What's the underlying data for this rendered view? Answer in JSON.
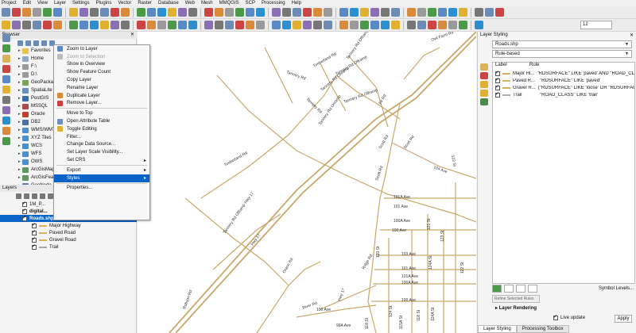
{
  "menubar": [
    "Project",
    "Edit",
    "View",
    "Layer",
    "Settings",
    "Plugins",
    "Vector",
    "Raster",
    "Database",
    "Web",
    "Mesh",
    "MMQGIS",
    "SCP",
    "Processing",
    "Help"
  ],
  "toolbar": {
    "scale_value": "12"
  },
  "browser": {
    "title": "Browser",
    "items": [
      {
        "label": "Favorites",
        "color": "#e8c24a"
      },
      {
        "label": "Home",
        "color": "#8fa9c9"
      },
      {
        "label": "F:\\",
        "color": "#9a9a9a"
      },
      {
        "label": "D:\\",
        "color": "#9a9a9a"
      },
      {
        "label": "GeoPackage",
        "color": "#7aa35b"
      },
      {
        "label": "SpatiaLite",
        "color": "#6a8fbf"
      },
      {
        "label": "PostGIS",
        "color": "#3d6ea8"
      },
      {
        "label": "MSSQL",
        "color": "#b04a4a"
      },
      {
        "label": "Oracle",
        "color": "#c04030"
      },
      {
        "label": "DB2",
        "color": "#4a6fa5"
      },
      {
        "label": "WMS/WMTS",
        "color": "#4a8fd0"
      },
      {
        "label": "XYZ Tiles",
        "color": "#4a8fd0"
      },
      {
        "label": "WCS",
        "color": "#4a8fd0"
      },
      {
        "label": "WFS",
        "color": "#4a8fd0"
      },
      {
        "label": "OWS",
        "color": "#4a8fd0"
      },
      {
        "label": "ArcGisMapServer",
        "color": "#5e9a5e"
      },
      {
        "label": "ArcGisFeatureServer",
        "color": "#5e9a5e"
      },
      {
        "label": "GeoNode",
        "color": "#5b7fa8"
      }
    ]
  },
  "layers": {
    "title": "Layers",
    "items": [
      {
        "label": "1M_P...",
        "indent": 28,
        "selected": false,
        "line_color": ""
      },
      {
        "label": "digital...",
        "indent": 28,
        "selected": false,
        "line_color": "",
        "bold": true
      },
      {
        "label": "Roads.shp",
        "indent": 28,
        "selected": true,
        "line_color": "",
        "bold": true
      },
      {
        "label": "Major Highway",
        "indent": 40,
        "selected": false,
        "line_color": "#d9b25a"
      },
      {
        "label": "Paved Road",
        "indent": 40,
        "selected": false,
        "line_color": "#d9b25a"
      },
      {
        "label": "Gravel Road",
        "indent": 40,
        "selected": false,
        "line_color": "#d9b25a"
      },
      {
        "label": "Trail",
        "indent": 40,
        "selected": false,
        "line_color": "#aaa"
      }
    ]
  },
  "context_menu": {
    "items": [
      {
        "label": "Zoom to Layer",
        "icon": "zoom-layer-icon",
        "color": "#5a8ac6",
        "disabled": false,
        "submenu": false
      },
      {
        "label": "Zoom to Selection",
        "icon": "zoom-selection-icon",
        "color": "#bbb",
        "disabled": true,
        "submenu": false
      },
      {
        "label": "Show in Overview",
        "icon": "",
        "color": "",
        "disabled": false,
        "submenu": false
      },
      {
        "label": "Show Feature Count",
        "icon": "",
        "color": "",
        "disabled": false,
        "submenu": false
      },
      {
        "label": "Copy Layer",
        "icon": "",
        "color": "",
        "disabled": false,
        "submenu": false
      },
      {
        "label": "Rename Layer",
        "icon": "",
        "color": "",
        "disabled": false,
        "submenu": false
      },
      {
        "label": "Duplicate Layer",
        "icon": "duplicate-icon",
        "color": "#d98a3a",
        "disabled": false,
        "submenu": false
      },
      {
        "label": "Remove Layer...",
        "icon": "remove-icon",
        "color": "#d04040",
        "disabled": false,
        "submenu": false
      },
      {
        "sep": true
      },
      {
        "label": "Move to Top",
        "icon": "",
        "color": "",
        "disabled": false,
        "submenu": false
      },
      {
        "label": "Open Attribute Table",
        "icon": "table-icon",
        "color": "#6a8fbf",
        "disabled": false,
        "submenu": false
      },
      {
        "label": "Toggle Editing",
        "icon": "pencil-icon",
        "color": "#e0b030",
        "disabled": false,
        "submenu": false
      },
      {
        "label": "Filter...",
        "icon": "",
        "color": "",
        "disabled": false,
        "submenu": false
      },
      {
        "label": "Change Data Source...",
        "icon": "",
        "color": "",
        "disabled": false,
        "submenu": false
      },
      {
        "label": "Set Layer Scale Visibility...",
        "icon": "",
        "color": "",
        "disabled": false,
        "submenu": false
      },
      {
        "label": "Set CRS",
        "icon": "",
        "color": "",
        "disabled": false,
        "submenu": true
      },
      {
        "sep": true
      },
      {
        "label": "Export",
        "icon": "",
        "color": "",
        "disabled": false,
        "submenu": true
      },
      {
        "label": "Styles",
        "icon": "",
        "color": "",
        "disabled": false,
        "submenu": true,
        "highlighted": true
      },
      {
        "sep": true
      },
      {
        "label": "Properties...",
        "icon": "",
        "color": "",
        "disabled": false,
        "submenu": false
      }
    ]
  },
  "map_labels": [
    "Tannery Rd",
    "Tannery Rd",
    "Timberland Rd",
    "Tannery Rd Offramp",
    "Tannery Rd Onramp",
    "Tannery Rd Onramp",
    "Timberland Rd",
    "Tannery Rd Offramp",
    "Tannery Rd Offramp",
    "Owl Farm Rd",
    "Fir Rd",
    "Scott Rd",
    "Scott Rd",
    "Scott Rd",
    "104 Ave",
    "122 St",
    "101A Ave",
    "101 Ave",
    "123 St",
    "100A Ave",
    "100 Ave",
    "121 St",
    "120 St",
    "103 Ave",
    "101 Ave",
    "101A Ave",
    "100A Ave",
    "100 Ave",
    "118 St",
    "124A St",
    "Hwy 17",
    "Tannery Rd Offramp Hwy 17",
    "Grace Rd",
    "River Rd",
    "Robson Rd",
    "Hwy 17",
    "100 Ave",
    "99A Ave",
    "124 St",
    "124A St",
    "118 St",
    "115A St",
    "Ridge Rd",
    "122 St"
  ],
  "layer_styling": {
    "title": "Layer Styling",
    "layer_name": "Roads.shp",
    "renderer": "Rule-based",
    "col_label": "Label",
    "col_rule": "Rule",
    "rules": [
      {
        "label": "Major Hi...",
        "rule": "\"RDSURFACE\" LIKE 'paved' AND \"ROAD_CLASS\"",
        "color": "#d9b25a"
      },
      {
        "label": "Paved R...",
        "rule": "\"RDSURFACE\" LIKE 'paved'",
        "color": "#d9b25a"
      },
      {
        "label": "Gravel R...",
        "rule": "(\"RDSURFACE\" LIKE 'loose' OR \"RDSURFACE\"",
        "color": "#d9b25a"
      },
      {
        "label": "Trail",
        "rule": "\"ROAD_CLASS\" LIKE 'trail'",
        "color": "#aaaaaa"
      }
    ],
    "symbol_levels": "Symbol Levels...",
    "refine": "Refine Selected Rules",
    "layer_rendering": "Layer Rendering",
    "live_update": "Live update",
    "apply": "Apply",
    "tabs": [
      "Layer Styling",
      "Processing Toolbox"
    ]
  }
}
